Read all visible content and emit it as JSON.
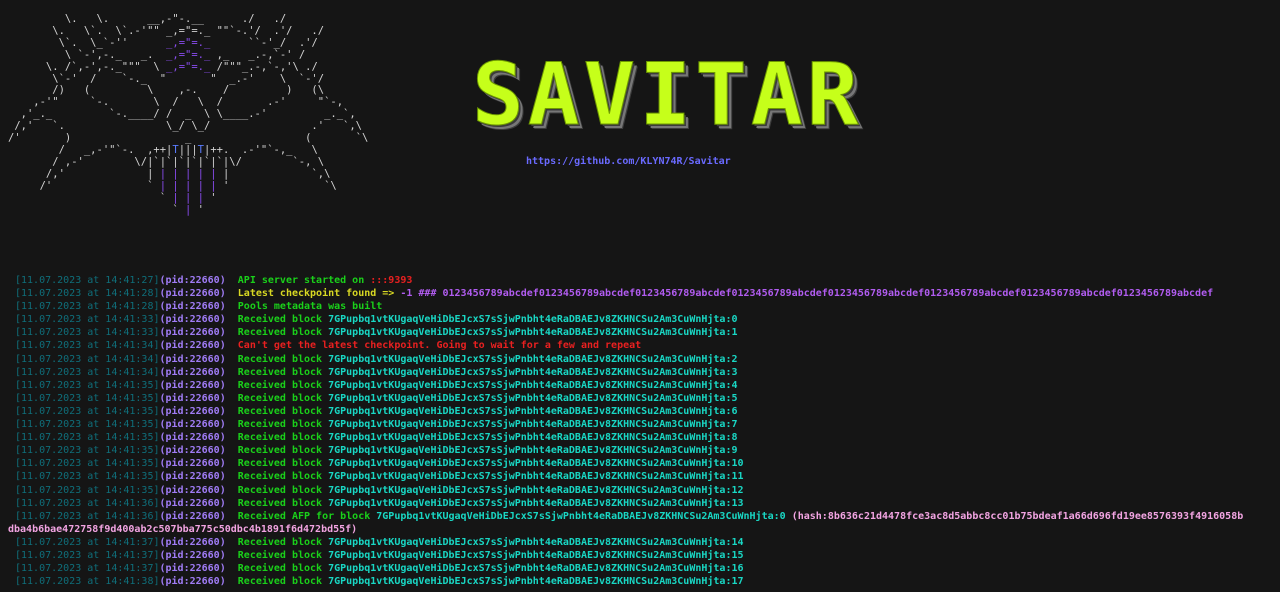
{
  "banner": {
    "logo_text": "SAVITAR",
    "repo_url": "https://github.com/KLYN74R/Savitar"
  },
  "log_lines": [
    {
      "ts": "[11.07.2023 at 14:41:27]",
      "pid": "(pid:22660)",
      "msg": "API server started on ",
      "msg_class": "g",
      "extra": ":::9393",
      "extra_class": "r"
    },
    {
      "ts": "[11.07.2023 at 14:41:28]",
      "pid": "(pid:22660)",
      "msg": "Latest checkpoint found => ",
      "msg_class": "y",
      "extra": "-1 ### 0123456789abcdef0123456789abcdef0123456789abcdef0123456789abcdef0123456789abcdef0123456789abcdef0123456789abcdef0123456789abcdef",
      "extra_class": "pu"
    },
    {
      "ts": "[11.07.2023 at 14:41:28]",
      "pid": "(pid:22660)",
      "msg": "Pools metadata was built",
      "msg_class": "g",
      "extra": "",
      "extra_class": "g"
    },
    {
      "ts": "[11.07.2023 at 14:41:33]",
      "pid": "(pid:22660)",
      "msg": "Received block ",
      "msg_class": "g",
      "extra": "7GPupbq1vtKUgaqVeHiDbEJcxS7sSjwPnbht4eRaDBAEJv8ZKHNCSu2Am3CuWnHjta:0",
      "extra_class": "h"
    },
    {
      "ts": "[11.07.2023 at 14:41:33]",
      "pid": "(pid:22660)",
      "msg": "Received block ",
      "msg_class": "g",
      "extra": "7GPupbq1vtKUgaqVeHiDbEJcxS7sSjwPnbht4eRaDBAEJv8ZKHNCSu2Am3CuWnHjta:1",
      "extra_class": "h"
    },
    {
      "ts": "[11.07.2023 at 14:41:34]",
      "pid": "(pid:22660)",
      "msg": "Can't get the latest checkpoint. Going to wait for a few and repeat",
      "msg_class": "r",
      "extra": "",
      "extra_class": "r"
    },
    {
      "ts": "[11.07.2023 at 14:41:34]",
      "pid": "(pid:22660)",
      "msg": "Received block ",
      "msg_class": "g",
      "extra": "7GPupbq1vtKUgaqVeHiDbEJcxS7sSjwPnbht4eRaDBAEJv8ZKHNCSu2Am3CuWnHjta:2",
      "extra_class": "h"
    },
    {
      "ts": "[11.07.2023 at 14:41:34]",
      "pid": "(pid:22660)",
      "msg": "Received block ",
      "msg_class": "g",
      "extra": "7GPupbq1vtKUgaqVeHiDbEJcxS7sSjwPnbht4eRaDBAEJv8ZKHNCSu2Am3CuWnHjta:3",
      "extra_class": "h"
    },
    {
      "ts": "[11.07.2023 at 14:41:35]",
      "pid": "(pid:22660)",
      "msg": "Received block ",
      "msg_class": "g",
      "extra": "7GPupbq1vtKUgaqVeHiDbEJcxS7sSjwPnbht4eRaDBAEJv8ZKHNCSu2Am3CuWnHjta:4",
      "extra_class": "h"
    },
    {
      "ts": "[11.07.2023 at 14:41:35]",
      "pid": "(pid:22660)",
      "msg": "Received block ",
      "msg_class": "g",
      "extra": "7GPupbq1vtKUgaqVeHiDbEJcxS7sSjwPnbht4eRaDBAEJv8ZKHNCSu2Am3CuWnHjta:5",
      "extra_class": "h"
    },
    {
      "ts": "[11.07.2023 at 14:41:35]",
      "pid": "(pid:22660)",
      "msg": "Received block ",
      "msg_class": "g",
      "extra": "7GPupbq1vtKUgaqVeHiDbEJcxS7sSjwPnbht4eRaDBAEJv8ZKHNCSu2Am3CuWnHjta:6",
      "extra_class": "h"
    },
    {
      "ts": "[11.07.2023 at 14:41:35]",
      "pid": "(pid:22660)",
      "msg": "Received block ",
      "msg_class": "g",
      "extra": "7GPupbq1vtKUgaqVeHiDbEJcxS7sSjwPnbht4eRaDBAEJv8ZKHNCSu2Am3CuWnHjta:7",
      "extra_class": "h"
    },
    {
      "ts": "[11.07.2023 at 14:41:35]",
      "pid": "(pid:22660)",
      "msg": "Received block ",
      "msg_class": "g",
      "extra": "7GPupbq1vtKUgaqVeHiDbEJcxS7sSjwPnbht4eRaDBAEJv8ZKHNCSu2Am3CuWnHjta:8",
      "extra_class": "h"
    },
    {
      "ts": "[11.07.2023 at 14:41:35]",
      "pid": "(pid:22660)",
      "msg": "Received block ",
      "msg_class": "g",
      "extra": "7GPupbq1vtKUgaqVeHiDbEJcxS7sSjwPnbht4eRaDBAEJv8ZKHNCSu2Am3CuWnHjta:9",
      "extra_class": "h"
    },
    {
      "ts": "[11.07.2023 at 14:41:35]",
      "pid": "(pid:22660)",
      "msg": "Received block ",
      "msg_class": "g",
      "extra": "7GPupbq1vtKUgaqVeHiDbEJcxS7sSjwPnbht4eRaDBAEJv8ZKHNCSu2Am3CuWnHjta:10",
      "extra_class": "h"
    },
    {
      "ts": "[11.07.2023 at 14:41:35]",
      "pid": "(pid:22660)",
      "msg": "Received block ",
      "msg_class": "g",
      "extra": "7GPupbq1vtKUgaqVeHiDbEJcxS7sSjwPnbht4eRaDBAEJv8ZKHNCSu2Am3CuWnHjta:11",
      "extra_class": "h"
    },
    {
      "ts": "[11.07.2023 at 14:41:35]",
      "pid": "(pid:22660)",
      "msg": "Received block ",
      "msg_class": "g",
      "extra": "7GPupbq1vtKUgaqVeHiDbEJcxS7sSjwPnbht4eRaDBAEJv8ZKHNCSu2Am3CuWnHjta:12",
      "extra_class": "h"
    },
    {
      "ts": "[11.07.2023 at 14:41:36]",
      "pid": "(pid:22660)",
      "msg": "Received block ",
      "msg_class": "g",
      "extra": "7GPupbq1vtKUgaqVeHiDbEJcxS7sSjwPnbht4eRaDBAEJv8ZKHNCSu2Am3CuWnHjta:13",
      "extra_class": "h"
    }
  ],
  "afp_line": {
    "ts": "[11.07.2023 at 14:41:36]",
    "pid": "(pid:22660)",
    "msg": "Received AFP for block ",
    "block": "7GPupbq1vtKUgaqVeHiDbEJcxS7sSjwPnbht4eRaDBAEJv8ZKHNCSu2Am3CuWnHjta:0",
    "hash_first": "(hash:8b636c21d4478fce3ac8d5abbc8cc01b75bdeaf1a66d696fd19ee8576393f4916058b",
    "hash_rest": "dba4b6bae472758f9d400ab2c507bba775c50dbc4b1891f6d472bd55f)"
  },
  "log_lines_after": [
    {
      "ts": "[11.07.2023 at 14:41:37]",
      "pid": "(pid:22660)",
      "msg": "Received block ",
      "msg_class": "g",
      "extra": "7GPupbq1vtKUgaqVeHiDbEJcxS7sSjwPnbht4eRaDBAEJv8ZKHNCSu2Am3CuWnHjta:14",
      "extra_class": "h"
    },
    {
      "ts": "[11.07.2023 at 14:41:37]",
      "pid": "(pid:22660)",
      "msg": "Received block ",
      "msg_class": "g",
      "extra": "7GPupbq1vtKUgaqVeHiDbEJcxS7sSjwPnbht4eRaDBAEJv8ZKHNCSu2Am3CuWnHjta:15",
      "extra_class": "h"
    },
    {
      "ts": "[11.07.2023 at 14:41:37]",
      "pid": "(pid:22660)",
      "msg": "Received block ",
      "msg_class": "g",
      "extra": "7GPupbq1vtKUgaqVeHiDbEJcxS7sSjwPnbht4eRaDBAEJv8ZKHNCSu2Am3CuWnHjta:16",
      "extra_class": "h"
    },
    {
      "ts": "[11.07.2023 at 14:41:38]",
      "pid": "(pid:22660)",
      "msg": "Received block ",
      "msg_class": "g",
      "extra": "7GPupbq1vtKUgaqVeHiDbEJcxS7sSjwPnbht4eRaDBAEJv8ZKHNCSu2Am3CuWnHjta:17",
      "extra_class": "h"
    }
  ],
  "colors": {
    "background": "#151515",
    "timestamp": "#0f6e7a",
    "pid": "#a07cf6",
    "success": "#1ad01a",
    "hash": "#19d7c4",
    "warning": "#d8d823",
    "error": "#e82020",
    "checkpoint": "#b15cf0",
    "afp_hash": "#f2a4e2",
    "logo": "#c6ff1a",
    "link": "#6a6aff"
  }
}
